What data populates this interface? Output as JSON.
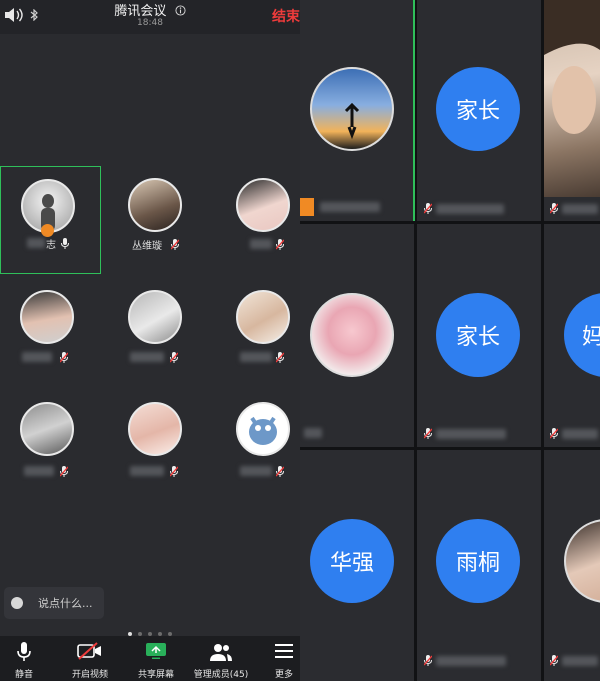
{
  "header": {
    "title": "腾讯会议",
    "time": "18:48",
    "end_label": "结束"
  },
  "participants_left": [
    {
      "name": "志",
      "mic": "on",
      "host": true,
      "active": true
    },
    {
      "name": "丛维璇",
      "mic": "muted"
    },
    {
      "name": "",
      "mic": "muted"
    },
    {
      "name": "",
      "mic": "muted"
    },
    {
      "name": "",
      "mic": "muted"
    },
    {
      "name": "",
      "mic": "muted"
    },
    {
      "name": "",
      "mic": "muted"
    },
    {
      "name": "",
      "mic": "muted"
    },
    {
      "name": "",
      "mic": "muted"
    }
  ],
  "chat": {
    "placeholder": "说点什么..."
  },
  "pager": {
    "pages": 5,
    "current": 1
  },
  "toolbar": {
    "mute": "静音",
    "video": "开启视频",
    "share": "共享屏幕",
    "members": "管理成员(45)",
    "more": "更多"
  },
  "participants_right": [
    {
      "label": "",
      "kind": "photo"
    },
    {
      "label": "家长",
      "kind": "initial"
    },
    {
      "label": "",
      "kind": "video"
    },
    {
      "label": "",
      "kind": "photo"
    },
    {
      "label": "家长",
      "kind": "initial"
    },
    {
      "label": "妈",
      "kind": "initial"
    },
    {
      "label": "华强",
      "kind": "initial"
    },
    {
      "label": "雨桐",
      "kind": "initial"
    },
    {
      "label": "",
      "kind": "photo"
    }
  ],
  "colors": {
    "accent_blue": "#2f7ff0",
    "end_red": "#ee3b3b",
    "active_green": "#2fbf5a"
  }
}
